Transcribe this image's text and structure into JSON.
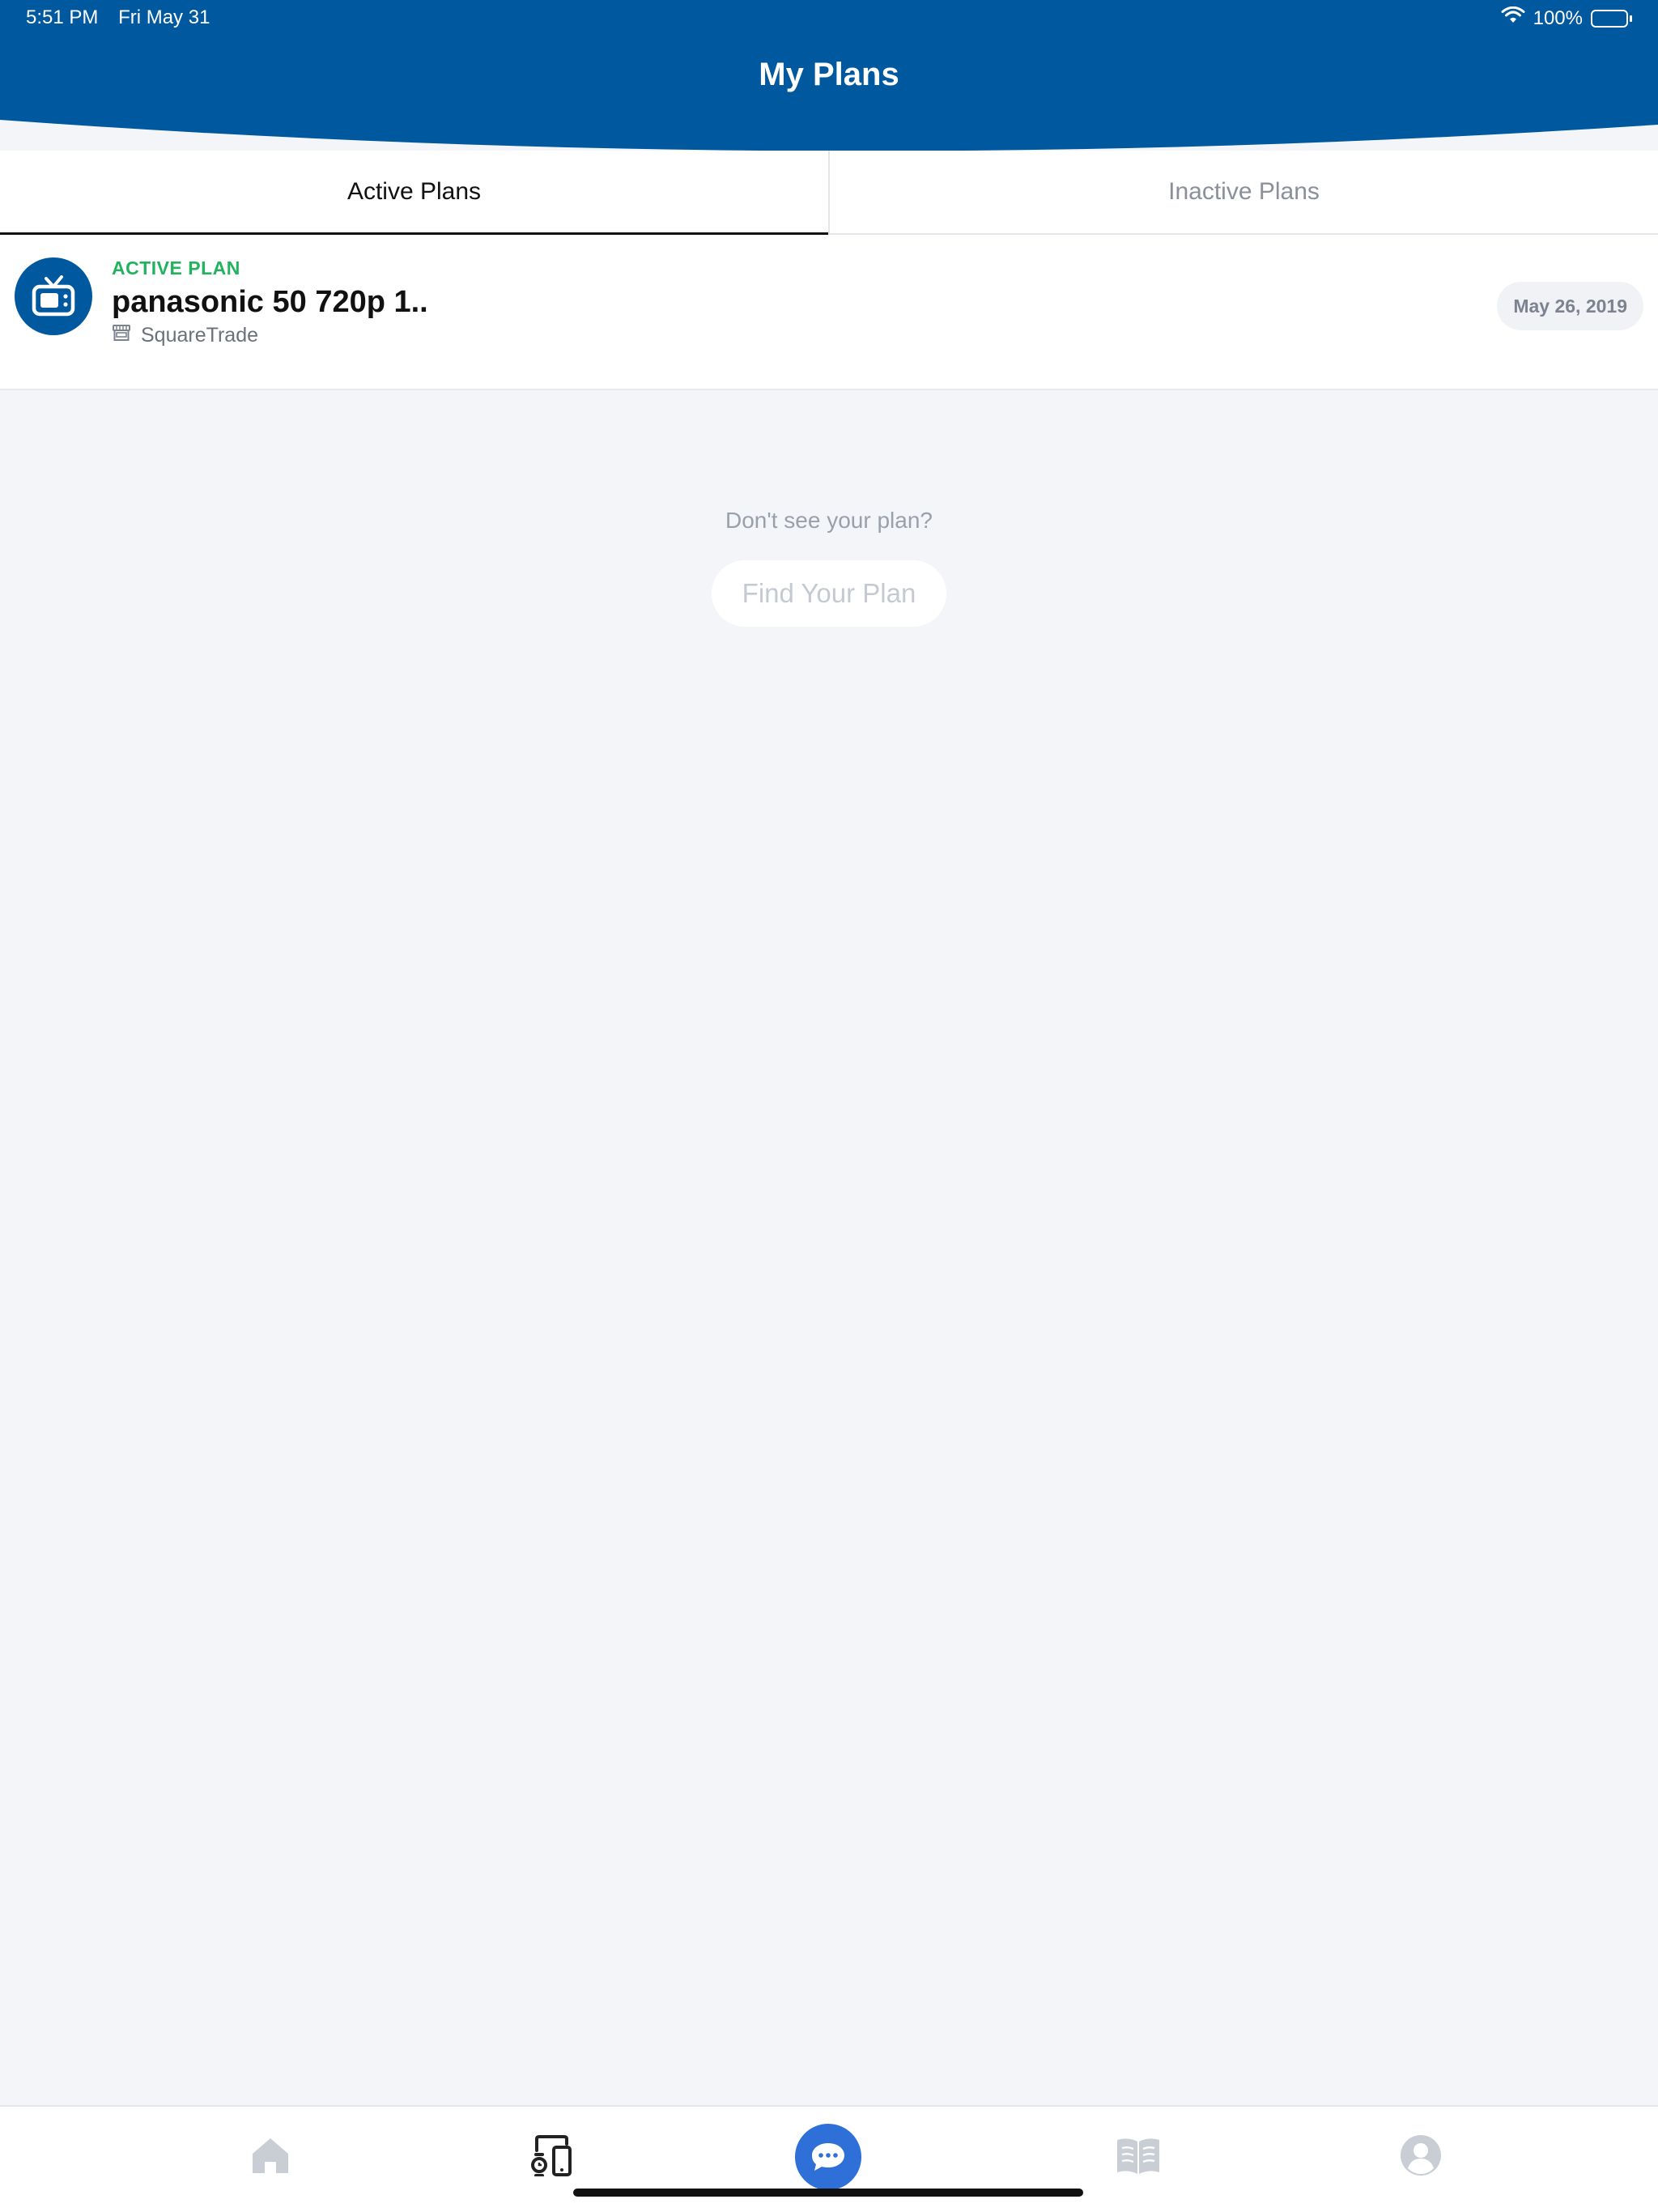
{
  "status_bar": {
    "time": "5:51 PM",
    "date": "Fri May 31",
    "battery_text": "100%",
    "battery_level": 1.0
  },
  "header": {
    "title": "My Plans",
    "color": "#00589f"
  },
  "tabs": [
    {
      "label": "Active Plans",
      "selected": true
    },
    {
      "label": "Inactive Plans",
      "selected": false
    }
  ],
  "plans": [
    {
      "status": "ACTIVE PLAN",
      "status_color": "#21b35d",
      "name": "panasonic 50 720p 1..",
      "provider": "SquareTrade",
      "date": "May 26, 2019",
      "icon": "tv-icon"
    }
  ],
  "empty_prompt": {
    "text": "Don't see your plan?",
    "button": "Find Your Plan"
  },
  "bottom_nav": [
    {
      "name": "home",
      "icon": "home-icon",
      "selected": false
    },
    {
      "name": "devices",
      "icon": "devices-icon",
      "selected": true
    },
    {
      "name": "chat",
      "icon": "chat-icon",
      "selected": false
    },
    {
      "name": "guides",
      "icon": "book-icon",
      "selected": false
    },
    {
      "name": "profile",
      "icon": "profile-icon",
      "selected": false
    }
  ],
  "colors": {
    "brand_blue": "#00589f",
    "chat_blue": "#2f6fd8",
    "active_green": "#21b35d",
    "background": "#f3f5f8"
  }
}
